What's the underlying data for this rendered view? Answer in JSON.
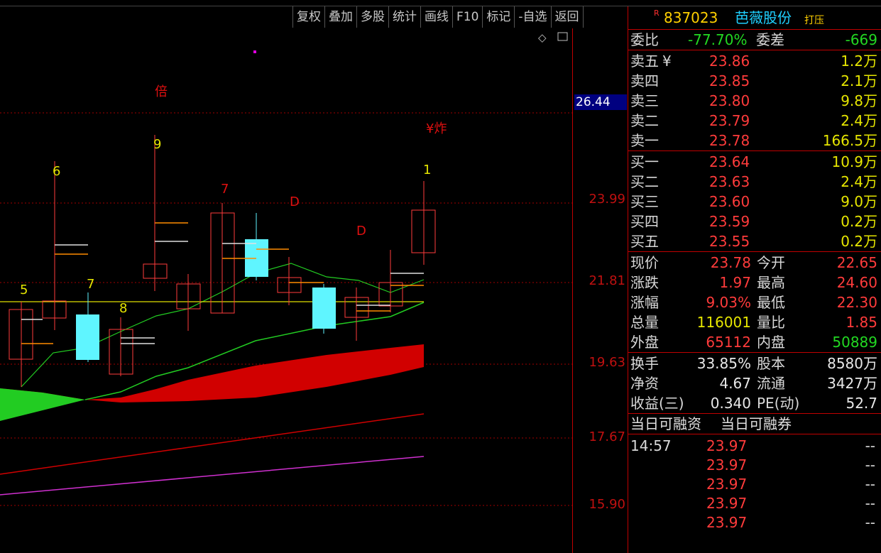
{
  "toolbar": [
    "复权",
    "叠加",
    "多股",
    "统计",
    "画线",
    "F10",
    "标记",
    "-自选",
    "返回"
  ],
  "header": {
    "rmark": "R",
    "code": "837023",
    "name": "芭薇股份",
    "tag": "打压"
  },
  "axis": {
    "current": "26.44",
    "ticks": [
      "23.99",
      "21.81",
      "19.63",
      "17.67",
      "15.90"
    ]
  },
  "chart_marks": {
    "bei": "倍",
    "zha": "¥炸",
    "d1": "D",
    "d2": "D",
    "n6": "6",
    "n9": "9",
    "n7a": "7",
    "n1": "1",
    "n5": "5",
    "n7b": "7",
    "n8": "8",
    "diamond": "◇"
  },
  "weibi": {
    "label1": "委比",
    "value1": "-77.70%",
    "label2": "委差",
    "value2": "-669"
  },
  "sells": [
    {
      "label": "卖五",
      "mark": "¥",
      "price": "23.86",
      "vol": "1.2万"
    },
    {
      "label": "卖四",
      "mark": "",
      "price": "23.85",
      "vol": "2.1万"
    },
    {
      "label": "卖三",
      "mark": "",
      "price": "23.80",
      "vol": "9.8万"
    },
    {
      "label": "卖二",
      "mark": "",
      "price": "23.79",
      "vol": "2.4万"
    },
    {
      "label": "卖一",
      "mark": "",
      "price": "23.78",
      "vol": "166.5万"
    }
  ],
  "buys": [
    {
      "label": "买一",
      "price": "23.64",
      "vol": "10.9万"
    },
    {
      "label": "买二",
      "price": "23.63",
      "vol": "2.4万"
    },
    {
      "label": "买三",
      "price": "23.60",
      "vol": "9.0万"
    },
    {
      "label": "买四",
      "price": "23.59",
      "vol": "0.2万"
    },
    {
      "label": "买五",
      "price": "23.55",
      "vol": "0.2万"
    }
  ],
  "stats": [
    {
      "l1": "现价",
      "v1": "23.78",
      "l2": "今开",
      "v2": "22.65"
    },
    {
      "l1": "涨跌",
      "v1": "1.97",
      "l2": "最高",
      "v2": "24.60"
    },
    {
      "l1": "涨幅",
      "v1": "9.03%",
      "l2": "最低",
      "v2": "22.30"
    },
    {
      "l1": "总量",
      "v1": "116001",
      "l2": "量比",
      "v2": "1.85"
    },
    {
      "l1": "外盘",
      "v1": "65112",
      "l2": "内盘",
      "v2": "50889"
    }
  ],
  "fund": [
    {
      "l1": "换手",
      "v1": "33.85%",
      "l2": "股本",
      "v2": "8580万"
    },
    {
      "l1": "净资",
      "v1": "4.67",
      "l2": "流通",
      "v2": "3427万"
    },
    {
      "l1": "收益(三)",
      "v1": "0.340",
      "l2": "PE(动)",
      "v2": "52.7"
    }
  ],
  "margin": {
    "label1": "当日可融资",
    "label2": "当日可融券"
  },
  "ticks_trades": [
    {
      "time": "14:57",
      "price": "23.97",
      "vol": "--"
    },
    {
      "time": "",
      "price": "23.97",
      "vol": "--"
    },
    {
      "time": "",
      "price": "23.97",
      "vol": "--"
    },
    {
      "time": "",
      "price": "23.97",
      "vol": "--"
    },
    {
      "time": "",
      "price": "23.97",
      "vol": "--"
    }
  ],
  "colors": {
    "up": "#ff3b3b",
    "down": "#5ff5ff",
    "ma": "#22c822",
    "bg": "#000000",
    "grid": "#a00000"
  }
}
